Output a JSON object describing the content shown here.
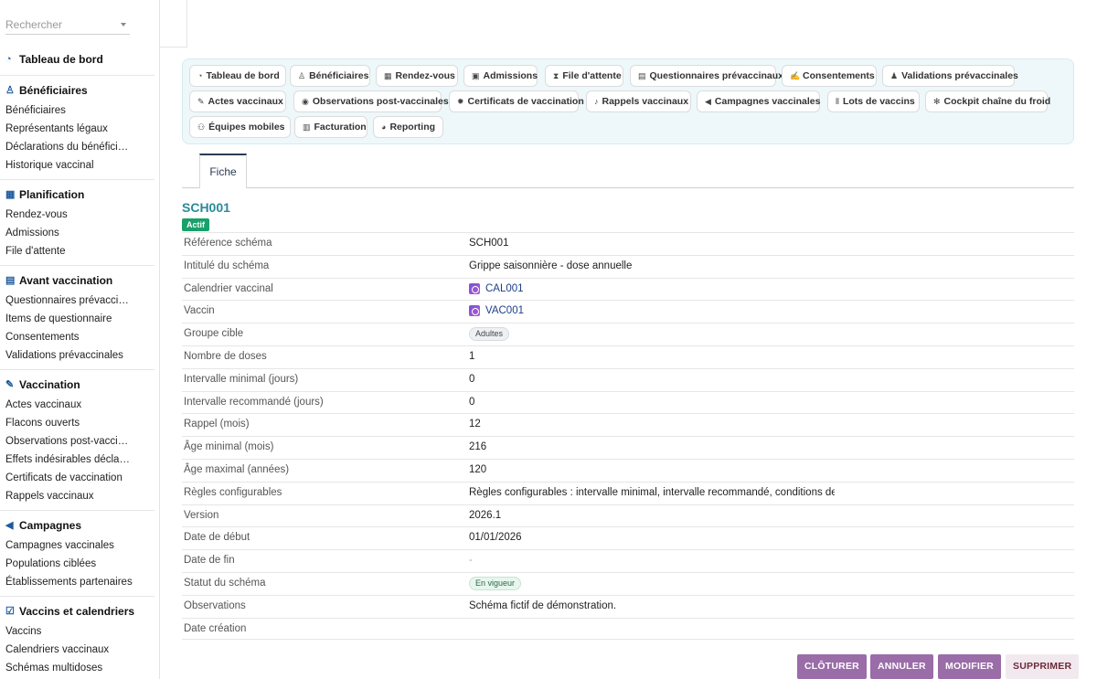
{
  "search": {
    "placeholder": "Rechercher"
  },
  "sidebar": {
    "sections": [
      {
        "title": "Tableau de bord",
        "icon": "dashboard-icon",
        "items": []
      },
      {
        "title": "Bénéficiaires",
        "icon": "users-icon",
        "items": [
          "Bénéficiaires",
          "Représentants légaux",
          "Déclarations du bénéficia…",
          "Historique vaccinal"
        ]
      },
      {
        "title": "Planification",
        "icon": "calendar-icon",
        "items": [
          "Rendez-vous",
          "Admissions",
          "File d'attente"
        ]
      },
      {
        "title": "Avant vaccination",
        "icon": "clipboard-icon",
        "items": [
          "Questionnaires prévaccin…",
          "Items de questionnaire",
          "Consentements",
          "Validations prévaccinales"
        ]
      },
      {
        "title": "Vaccination",
        "icon": "syringe-icon",
        "items": [
          "Actes vaccinaux",
          "Flacons ouverts",
          "Observations post-vaccin…",
          "Effets indésirables déclarés",
          "Certificats de vaccination",
          "Rappels vaccinaux"
        ]
      },
      {
        "title": "Campagnes",
        "icon": "megaphone-icon",
        "items": [
          "Campagnes vaccinales",
          "Populations ciblées",
          "Établissements partenaires"
        ]
      },
      {
        "title": "Vaccins et calendriers",
        "icon": "checklist-icon",
        "items": [
          "Vaccins",
          "Calendriers vaccinaux",
          "Schémas multidoses"
        ]
      }
    ]
  },
  "nav": {
    "pills": [
      {
        "label": "Tableau de bord",
        "icon": "dashboard-icon"
      },
      {
        "label": "Bénéficiaires",
        "icon": "users-icon"
      },
      {
        "label": "Rendez-vous",
        "icon": "calendar-icon"
      },
      {
        "label": "Admissions",
        "icon": "clipboard-check-icon"
      },
      {
        "label": "File d'attente",
        "icon": "hourglass-icon"
      },
      {
        "label": "Questionnaires prévaccinaux",
        "icon": "form-icon"
      },
      {
        "label": "Consentements",
        "icon": "signature-icon"
      },
      {
        "label": "Validations prévaccinales",
        "icon": "user-check-icon"
      },
      {
        "label": "Actes vaccinaux",
        "icon": "syringe-icon"
      },
      {
        "label": "Observations post-vaccinales",
        "icon": "eye-icon"
      },
      {
        "label": "Certificats de vaccination",
        "icon": "certificate-icon"
      },
      {
        "label": "Rappels vaccinaux",
        "icon": "bell-icon"
      },
      {
        "label": "Campagnes vaccinales",
        "icon": "megaphone-icon"
      },
      {
        "label": "Lots de vaccins",
        "icon": "barcode-icon"
      },
      {
        "label": "Cockpit chaîne du froid",
        "icon": "snowflake-icon"
      },
      {
        "label": "Équipes mobiles",
        "icon": "team-icon"
      },
      {
        "label": "Facturation",
        "icon": "invoice-icon"
      },
      {
        "label": "Reporting",
        "icon": "pie-chart-icon"
      }
    ]
  },
  "tabs": {
    "fiche": "Fiche"
  },
  "record": {
    "title": "SCH001",
    "badge": "Actif",
    "fields": [
      {
        "label": "Référence schéma",
        "value": "SCH001"
      },
      {
        "label": "Intitulé du schéma",
        "value": "Grippe saisonnière - dose annuelle"
      },
      {
        "label": "Calendrier vaccinal",
        "value": "CAL001",
        "kind": "link"
      },
      {
        "label": "Vaccin",
        "value": "VAC001",
        "kind": "link"
      },
      {
        "label": "Groupe cible",
        "value": "Adultes",
        "kind": "tag-grey"
      },
      {
        "label": "Nombre de doses",
        "value": "1"
      },
      {
        "label": "Intervalle minimal (jours)",
        "value": "0"
      },
      {
        "label": "Intervalle recommandé (jours)",
        "value": "0"
      },
      {
        "label": "Rappel (mois)",
        "value": "12"
      },
      {
        "label": "Âge minimal (mois)",
        "value": "216"
      },
      {
        "label": "Âge maximal (années)",
        "value": "120"
      },
      {
        "label": "Règles configurables",
        "value": "Règles configurables : intervalle minimal, intervalle recommandé, conditions de …"
      },
      {
        "label": "Version",
        "value": "2026.1"
      },
      {
        "label": "Date de début",
        "value": "01/01/2026"
      },
      {
        "label": "Date de fin",
        "value": "-",
        "kind": "muted"
      },
      {
        "label": "Statut du schéma",
        "value": "En vigueur",
        "kind": "tag-green"
      },
      {
        "label": "Observations",
        "value": "Schéma fictif de démonstration."
      },
      {
        "label": "Date création",
        "value": ""
      }
    ]
  },
  "actions": {
    "cloturer": "CLÔTURER",
    "annuler": "ANNULER",
    "modifier": "MODIFIER",
    "supprimer": "SUPPRIMER"
  },
  "colors": {
    "accent": "#2a8a99",
    "button": "#9a6ca8",
    "badge": "#1aa06a"
  }
}
